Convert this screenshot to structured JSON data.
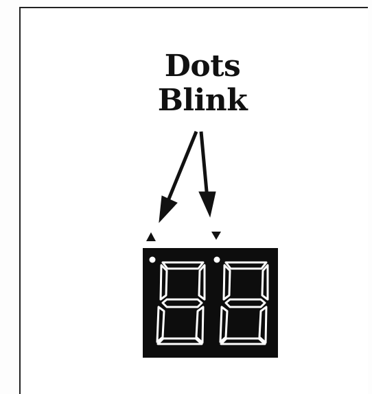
{
  "caption": {
    "line1": "Dots",
    "line2": "Blink"
  },
  "display": {
    "digit_count": 2,
    "dot_count": 2,
    "background_color": "#0d0d0d",
    "segment_outline_color": "#ffffff"
  },
  "pointer_icons": [
    "arrow-up-indicator-icon",
    "arrow-down-indicator-icon"
  ]
}
